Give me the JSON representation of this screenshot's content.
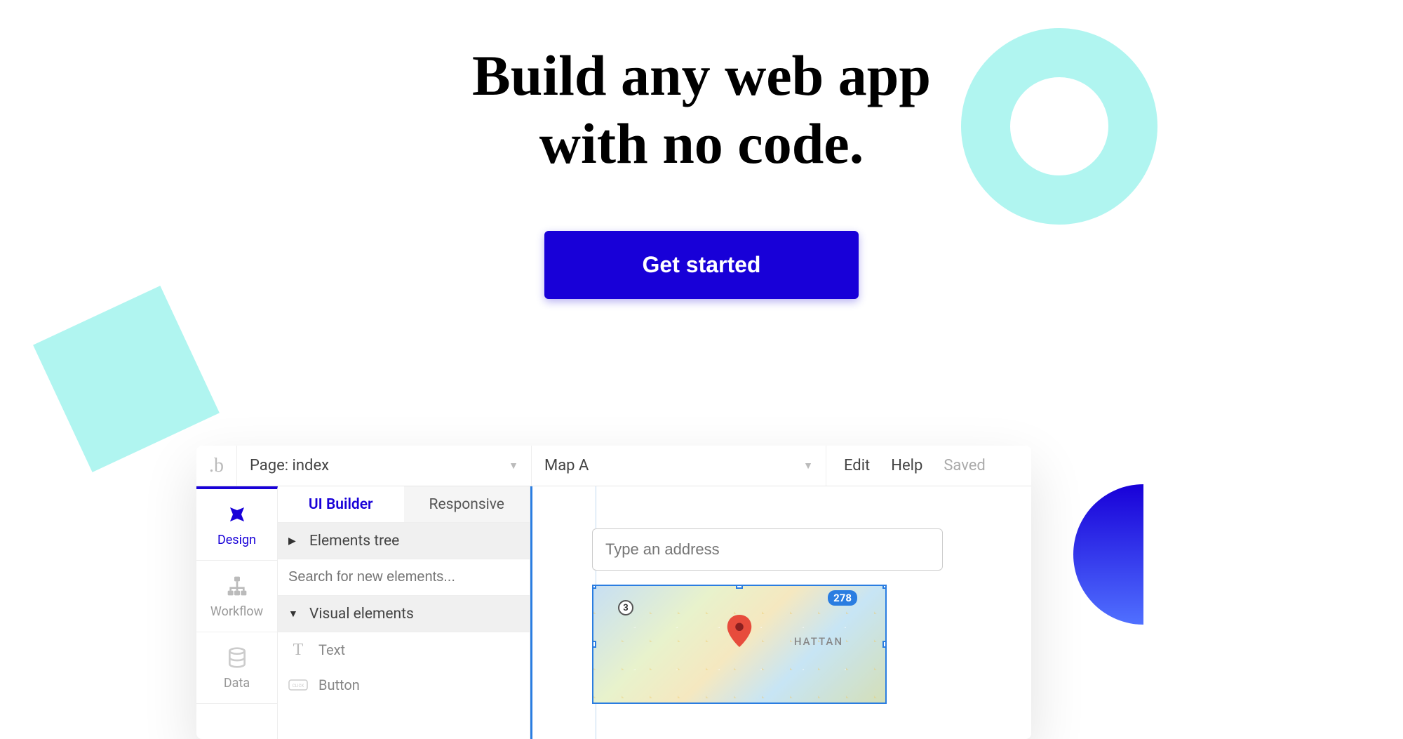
{
  "hero": {
    "title_line1": "Build any web app",
    "title_line2": "with no code.",
    "cta_label": "Get started"
  },
  "editor": {
    "topbar": {
      "page_label": "Page: index",
      "element_label": "Map A",
      "menu": {
        "edit": "Edit",
        "help": "Help",
        "saved": "Saved"
      }
    },
    "sidebar": {
      "design": "Design",
      "workflow": "Workflow",
      "data": "Data"
    },
    "panel": {
      "tabs": {
        "ui_builder": "UI Builder",
        "responsive": "Responsive"
      },
      "elements_tree": "Elements tree",
      "search_placeholder": "Search for new elements...",
      "visual_elements": "Visual elements",
      "items": {
        "text": "Text",
        "button": "Button"
      }
    },
    "canvas": {
      "address_placeholder": "Type an address",
      "route_badge": "278",
      "route_circle": "3",
      "map_label": "HATTAN"
    }
  },
  "colors": {
    "primary": "#1800d8",
    "cyan": "#b0f5f0",
    "selection": "#2a7de1"
  }
}
